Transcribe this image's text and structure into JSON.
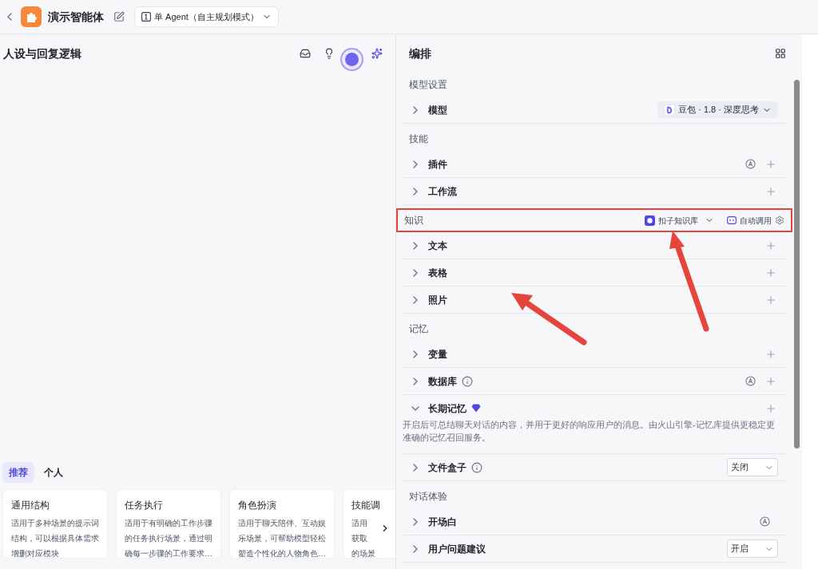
{
  "header": {
    "title": "演示智能体",
    "mode": "单 Agent（自主规划模式）"
  },
  "prompt_panel": {
    "title": "人设与回复逻辑",
    "tabs": [
      {
        "label": "推荐",
        "selected": true
      },
      {
        "label": "个人",
        "selected": false
      }
    ],
    "templates": [
      {
        "title": "通用结构",
        "lines": [
          "适用于多种场景的提示词",
          "结构，可以根据具体需求",
          "增删对应模块"
        ]
      },
      {
        "title": "任务执行",
        "lines": [
          "适用于有明确的工作步骤",
          "的任务执行场景，通过明",
          "确每一步骤的工作要求…"
        ]
      },
      {
        "title": "角色扮演",
        "lines": [
          "适用于聊天陪伴、互动娱",
          "乐场景，可帮助模型轻松",
          "塑造个性化的人物角色…"
        ]
      },
      {
        "title": "技能调",
        "lines": [
          "适用",
          "获取",
          "的场景"
        ]
      }
    ]
  },
  "arrange_panel": {
    "title": "编排",
    "sections": [
      {
        "title": "模型设置",
        "items": [
          {
            "label": "模型",
            "expanded": false,
            "model": "豆包 · 1.8 · 深度思考"
          }
        ]
      },
      {
        "title": "技能",
        "items": [
          {
            "label": "插件",
            "expanded": false,
            "auto": true,
            "add": true
          },
          {
            "label": "工作流",
            "expanded": false,
            "add": true
          }
        ]
      },
      {
        "title": "知识",
        "highlighted": true,
        "source": "扣子知识库",
        "call_mode": "自动调用",
        "items": [
          {
            "label": "文本",
            "expanded": false,
            "add": true
          },
          {
            "label": "表格",
            "expanded": false,
            "add": true
          },
          {
            "label": "照片",
            "expanded": false,
            "add": true
          }
        ]
      },
      {
        "title": "记忆",
        "items": [
          {
            "label": "变量",
            "expanded": false,
            "add": true
          },
          {
            "label": "数据库",
            "expanded": false,
            "info": true,
            "auto": true,
            "add": true
          },
          {
            "label": "长期记忆",
            "expanded": true,
            "premium": true,
            "add": true,
            "description": "开启后可总结聊天对话的内容，并用于更好的响应用户的消息。由火山引擎-记忆库提供更稳定更准确的记忆召回服务。"
          },
          {
            "label": "文件盒子",
            "expanded": false,
            "info": true,
            "select": "关闭"
          }
        ]
      },
      {
        "title": "对话体验",
        "items": [
          {
            "label": "开场白",
            "expanded": false,
            "auto": true
          },
          {
            "label": "用户问题建议",
            "expanded": false,
            "select": "开启"
          }
        ]
      }
    ]
  }
}
